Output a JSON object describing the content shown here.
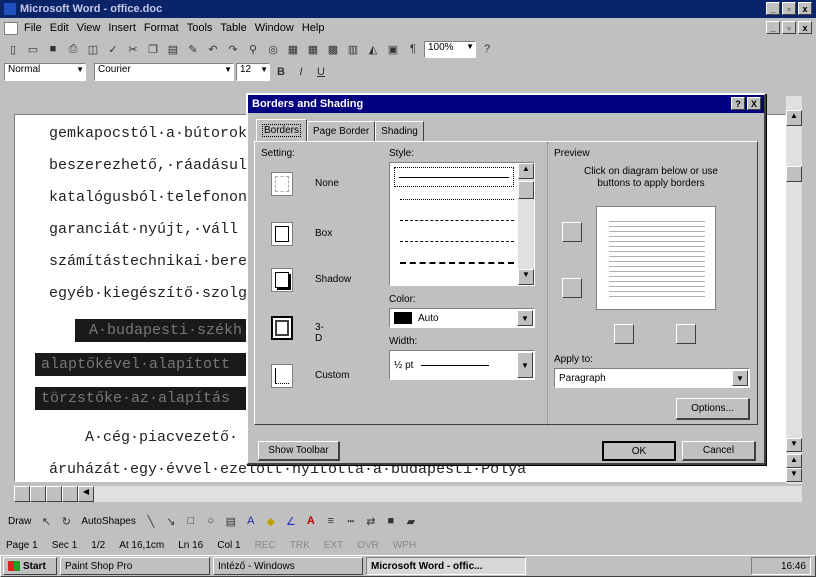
{
  "window": {
    "title": "Microsoft Word - office.doc",
    "minimize": "_",
    "maximize": "▫",
    "close": "x"
  },
  "menu": [
    "File",
    "Edit",
    "View",
    "Insert",
    "Format",
    "Tools",
    "Table",
    "Window",
    "Help"
  ],
  "toolbar": {
    "zoom": "100%",
    "style": "Normal",
    "font": "Courier",
    "size": "12",
    "bold": "B",
    "italic": "I",
    "underline": "U"
  },
  "document": {
    "lines": [
      "gemkapocstól·a·bútorok",
      "beszerezhető,·ráadásul",
      "katalógusból·telefonon",
      "garanciát·nyújt,·váll",
      "számítástechnikai·bere",
      "egyéb·kiegészítő·szolg"
    ],
    "highlighted": [
      "A·budapesti·székh",
      "alaptőkével·alapított",
      "törzstőke·az·alapítás"
    ],
    "bottom": [
      "A·cég·piacvezető·",
      "áruházát·egy·évvel·ezelőtt·nyitotta·a·budapesti·Pólya"
    ]
  },
  "dialog": {
    "title": "Borders and Shading",
    "help": "?",
    "close": "X",
    "tabs": [
      "Borders",
      "Page Border",
      "Shading"
    ],
    "setting_label": "Setting:",
    "settings": [
      "None",
      "Box",
      "Shadow",
      "3-D",
      "Custom"
    ],
    "style_label": "Style:",
    "color_label": "Color:",
    "color_value": "Auto",
    "width_label": "Width:",
    "width_value": "½ pt",
    "preview_label": "Preview",
    "preview_hint": "Click on diagram below or use buttons to apply borders",
    "apply_label": "Apply to:",
    "apply_value": "Paragraph",
    "options": "Options...",
    "show_toolbar": "Show Toolbar",
    "ok": "OK",
    "cancel": "Cancel"
  },
  "draw": {
    "draw": "Draw",
    "autoshapes": "AutoShapes"
  },
  "status": {
    "page": "Page 1",
    "sec": "Sec 1",
    "pages": "1/2",
    "at": "At 16,1cm",
    "ln": "Ln 16",
    "col": "Col 1",
    "rec": "REC",
    "trk": "TRK",
    "ext": "EXT",
    "ovr": "OVR",
    "wph": "WPH"
  },
  "taskbar": {
    "start": "Start",
    "tasks": [
      "Paint Shop Pro",
      "Intéző - Windows",
      "Microsoft Word - offic..."
    ],
    "time": "16:46"
  }
}
